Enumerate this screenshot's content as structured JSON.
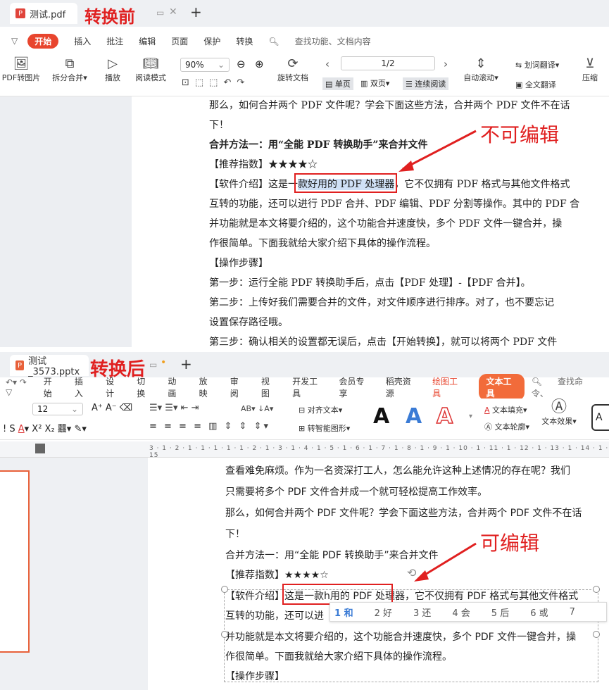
{
  "top": {
    "tab_title": "测试.pdf",
    "label": "转换前",
    "plus": "+",
    "menu": [
      "开始",
      "插入",
      "批注",
      "编辑",
      "页面",
      "保护",
      "转换"
    ],
    "search": "查找功能、文档内容",
    "ribbon": {
      "pdf_to_img": "PDF转图片",
      "split_merge": "拆分合并",
      "play": "播放",
      "read_mode": "阅读模式",
      "zoom": "90%",
      "rotate": "旋转文档",
      "page": "1/2",
      "single": "单页",
      "double": "双页",
      "continuous": "连续阅读",
      "auto_scroll": "自动滚动",
      "word_translate": "划词翻译",
      "full_translate": "全文翻译",
      "compress": "压缩"
    },
    "annotation": "不可编辑",
    "lines": [
      "那么，如何合并两个 PDF 文件呢？学会下面这些方法，合并两个 PDF 文件不在话",
      "下！",
      "合并方法一：用“全能 PDF 转换助手”来合并文件",
      "【推荐指数】★★★★☆",
      "互转的功能，还可以进行 PDF 合并、PDF 编辑、PDF 分割等操作。其中的 PDF 合",
      "并功能就是本文将要介绍的，这个功能合并速度快，多个 PDF 文件一键合并，操",
      "作很简单。下面我就给大家介绍下具体的操作流程。",
      "【操作步骤】",
      "第一步：运行全能 PDF 转换助手后，点击【PDF 处理】-【PDF 合并】。",
      "第二步：上传好我们需要合并的文件，对文件顺序进行排序。对了，也不要忘记",
      "设置保存路径哦。",
      "第三步：确认相关的设置都无误后，点击【开始转换】，就可以将两个 PDF 文件"
    ],
    "intro_pre": "【软件介绍】这是一",
    "intro_hl": "款好用的 PDF 处理器",
    "intro_post": "，它不仅拥有 PDF 格式与其他文件格式"
  },
  "bottom": {
    "tab_title": "测试_3573.pptx",
    "label": "转换后",
    "plus": "+",
    "menu": [
      "开始",
      "插入",
      "设计",
      "切换",
      "动画",
      "放映",
      "审阅",
      "视图",
      "开发工具",
      "会员专享",
      "稻壳资源"
    ],
    "draw_tools": "绘图工具",
    "text_tools": "文本工具",
    "search": "查找命令、",
    "ribbon": {
      "font_size": "12",
      "align_text": "对齐文本",
      "smart_shape": "转智能图形",
      "text_fill": "文本填充",
      "text_outline": "文本轮廓",
      "text_effect": "文本效果",
      "big_a": "A"
    },
    "ruler": "3 · 1 · 2 · 1 · 1 · 1 · 1 · 1 · 2 · 1 · 3 · 1 · 4 · 1 · 5 · 1 · 6 · 1 · 7 · 1 · 8 · 1 · 9 · 1 · 10 · 1 · 11 · 1 · 12 · 1 · 13 · 1 · 14 · 1 · 15",
    "annotation": "可编辑",
    "lines": [
      "查看难免麻烦。作为一名资深打工人，怎么能允许这种上述情况的存在呢？我们",
      "只需要将多个 PDF 文件合并成一个就可轻松提高工作效率。",
      "那么，如何合并两个 PDF 文件呢？学会下面这些方法，合并两个 PDF 文件不在话",
      "下！",
      "合并方法一：用“全能 PDF 转换助手”来合并文件",
      "【推荐指数】★★★★☆"
    ],
    "intro_pre": "【软件介绍】",
    "intro_box": "这是一款h用的 PDF 处理器",
    "intro_post": "，它不仅拥有 PDF 格式与其他文件格式",
    "line_func": "互转的功能，还可以进",
    "ime": [
      "1 和",
      "2 好",
      "3 还",
      "4 会",
      "5 后",
      "6 或",
      "7"
    ],
    "lines2": [
      "并功能就是本文将要介绍的，这个功能合并速度快，多个 PDF 文件一键合并，操",
      "作很简单。下面我就给大家介绍下具体的操作流程。",
      "【操作步骤】"
    ]
  }
}
